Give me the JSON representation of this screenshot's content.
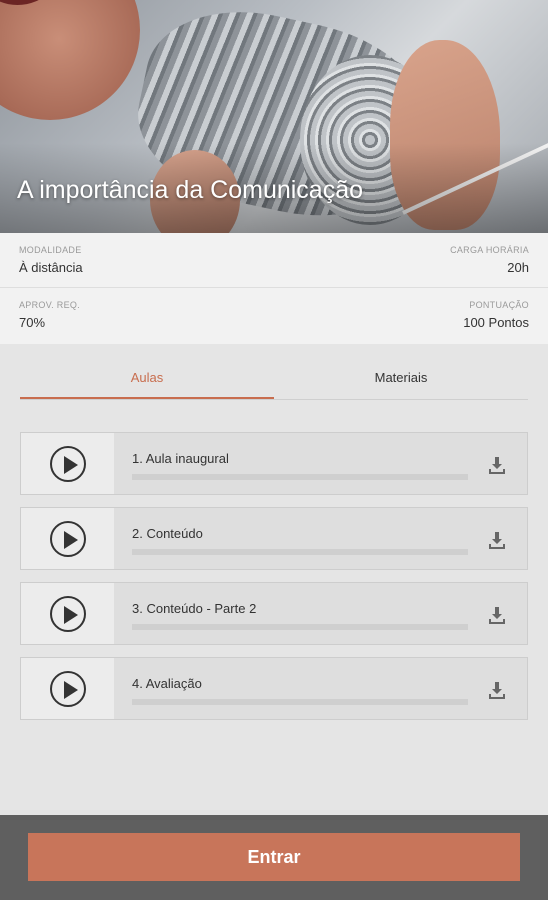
{
  "course": {
    "title": "A importância da Comunicação"
  },
  "info": {
    "modalidade_label": "MODALIDADE",
    "modalidade_value": "À distância",
    "carga_label": "CARGA HORÁRIA",
    "carga_value": "20h",
    "aprov_label": "APROV. REQ.",
    "aprov_value": "70%",
    "pontuacao_label": "PONTUAÇÃO",
    "pontuacao_value": "100 Pontos"
  },
  "tabs": [
    {
      "label": "Aulas",
      "active": true
    },
    {
      "label": "Materiais",
      "active": false
    }
  ],
  "lessons": [
    {
      "title": "1. Aula inaugural",
      "progress": 0
    },
    {
      "title": "2. Conteúdo",
      "progress": 0
    },
    {
      "title": "3. Conteúdo - Parte 2",
      "progress": 0
    },
    {
      "title": "4. Avaliação",
      "progress": 0
    }
  ],
  "footer": {
    "enter_label": "Entrar"
  },
  "colors": {
    "accent": "#c86d4e",
    "button": "#c8755a",
    "footer": "#5f5f5f"
  },
  "icons": {
    "play": "play-circle-icon",
    "download": "download-icon"
  }
}
